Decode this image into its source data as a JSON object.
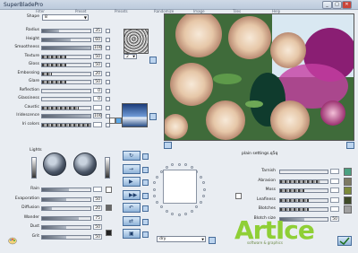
{
  "window": {
    "title": "SuperBladePro",
    "min": "_",
    "max": "□",
    "close": "✕",
    "close_color": "#c9453a"
  },
  "menu": [
    "Filter",
    "Preset",
    "Presets",
    "Randomize",
    "Image",
    "Tiles",
    "Help"
  ],
  "shape": {
    "label": "Shape",
    "value": "8"
  },
  "sliders_top": [
    {
      "label": "Radius",
      "value": "35",
      "level": 0.35
    },
    {
      "label": "Height",
      "value": "60",
      "level": 0.6
    },
    {
      "label": "Smoothness",
      "value": "100",
      "level": 1.0
    },
    {
      "label": "Texture",
      "value": "50",
      "level": 0.5,
      "textured": true
    },
    {
      "label": "Gloss",
      "value": "50",
      "level": 0.5,
      "textured": true
    },
    {
      "label": "Embossing",
      "value": "20",
      "level": 0.2,
      "textured": true
    },
    {
      "label": "Glare",
      "value": "50",
      "level": 0.5,
      "textured": true
    },
    {
      "label": "Reflection",
      "value": "0",
      "level": 0.0
    },
    {
      "label": "Glassiness",
      "value": "0",
      "level": 0.0
    },
    {
      "label": "Caustic",
      "value": "",
      "level": 0.75,
      "textured": true
    },
    {
      "label": "Iridescence",
      "value": "100",
      "level": 1.0
    },
    {
      "label": "Iri colors",
      "value": "",
      "level": 1.0,
      "textured": true
    }
  ],
  "texture_number": "2",
  "lights_label": "Lights",
  "sliders_bottom": [
    {
      "label": "Rain",
      "value": "",
      "level": 0.55
    },
    {
      "label": "Evaporation",
      "value": "50",
      "level": 0.5
    },
    {
      "label": "Diffusion",
      "value": "20",
      "level": 0.2
    },
    {
      "label": "Wander",
      "value": "75",
      "level": 0.75
    },
    {
      "label": "Dust",
      "value": "50",
      "level": 0.5
    },
    {
      "label": "Grit",
      "value": "50",
      "level": 0.5
    }
  ],
  "preset_file": "plain settings.q5q",
  "preset_dropdown": "dry",
  "right_sliders": [
    {
      "label": "Tarnish",
      "value": "",
      "level": 0.0,
      "color": "#4aa080"
    },
    {
      "label": "Abrasion",
      "value": "",
      "level": 0.85,
      "color": "#7d7a63",
      "textured": true
    },
    {
      "label": "Moss",
      "value": "",
      "level": 0.5,
      "color": "#7c8a3a",
      "textured": true
    },
    {
      "label": "Leafiness",
      "value": "",
      "level": 0.6,
      "color": "#3e4a28",
      "textured": true
    },
    {
      "label": "Blotches",
      "value": "",
      "level": 0.6,
      "color": "#a0a0a0",
      "textured": true
    },
    {
      "label": "Blotch size",
      "value": "50",
      "level": 0.5,
      "color": ""
    }
  ],
  "watermark": {
    "text": "ArtIce",
    "sub": "software & graphics"
  }
}
